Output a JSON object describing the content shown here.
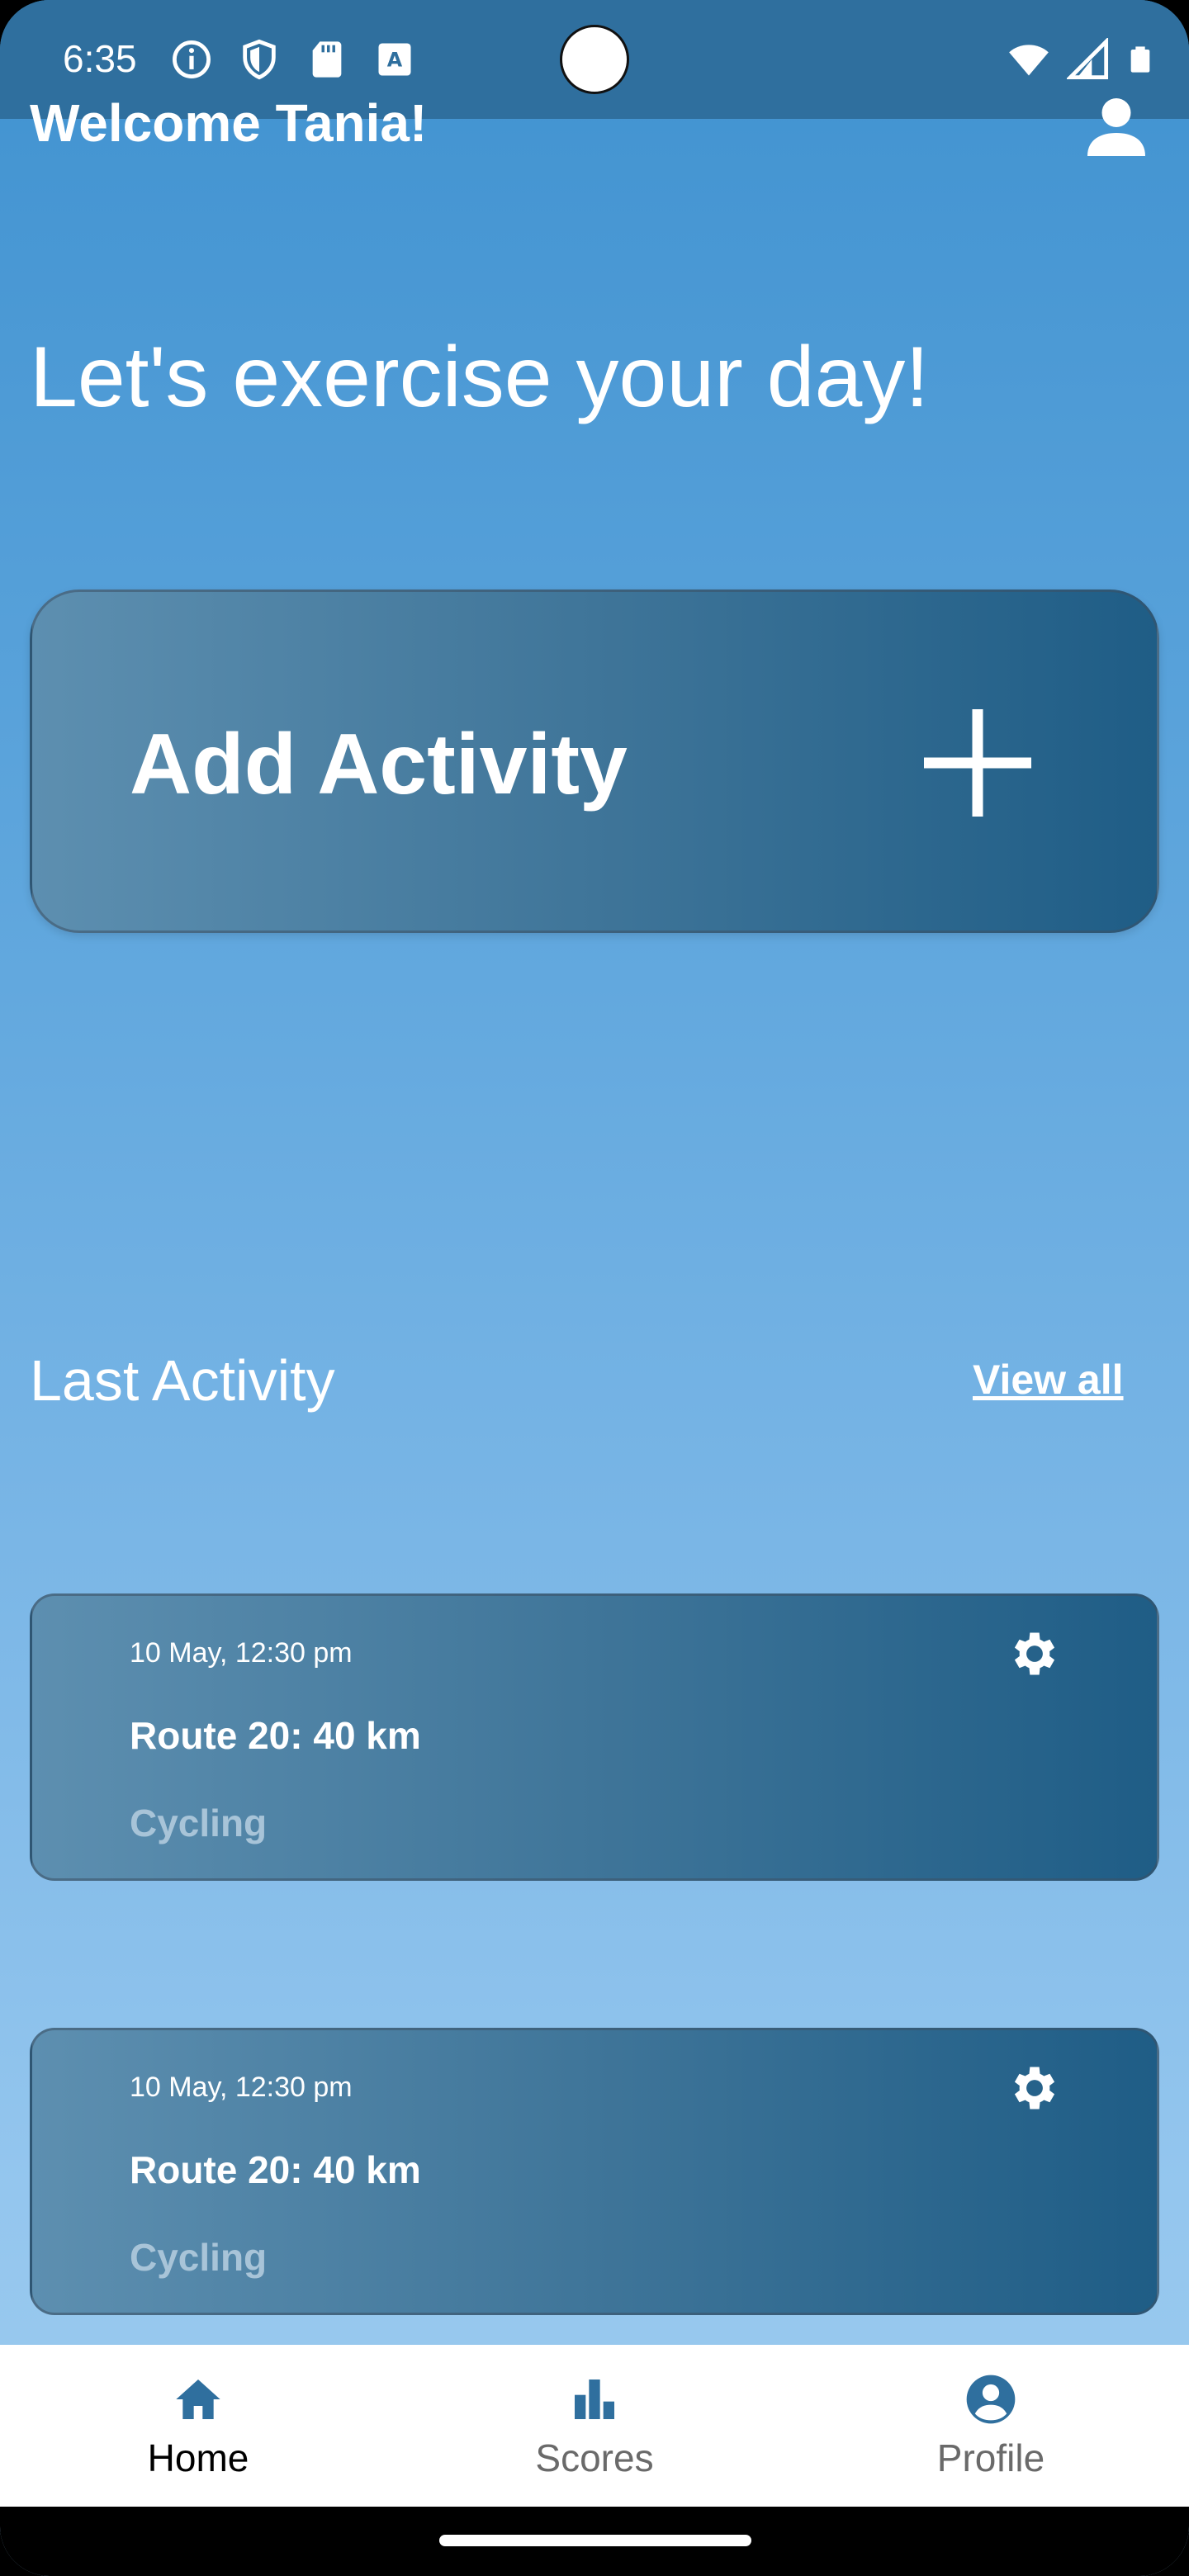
{
  "status_bar": {
    "time": "6:35",
    "left_icons": [
      "info-icon",
      "shield-icon",
      "sd-card-icon",
      "text-a-icon"
    ],
    "right_icons": [
      "wifi-icon",
      "signal-icon",
      "battery-icon"
    ]
  },
  "header": {
    "welcome": "Welcome Tania!",
    "profile_icon": "person-icon"
  },
  "tagline": "Let's exercise your day!",
  "add_activity": {
    "label": "Add Activity",
    "icon": "plus-icon"
  },
  "last_activity": {
    "title": "Last Activity",
    "view_all": "View all",
    "items": [
      {
        "date": "10 May, 12:30 pm",
        "route": "Route 20: 40 km",
        "type": "Cycling"
      },
      {
        "date": "10 May, 12:30 pm",
        "route": "Route 20: 40 km",
        "type": "Cycling"
      }
    ]
  },
  "bottom_nav": {
    "items": [
      {
        "label": "Home",
        "icon": "home-icon",
        "active": true
      },
      {
        "label": "Scores",
        "icon": "bar-chart-icon",
        "active": false
      },
      {
        "label": "Profile",
        "icon": "account-circle-icon",
        "active": false
      }
    ]
  },
  "colors": {
    "accent": "#2f6f9e",
    "card_start": "#5d8fb0",
    "card_end": "#1f5d86",
    "nav_icon": "#2f6f9e"
  }
}
